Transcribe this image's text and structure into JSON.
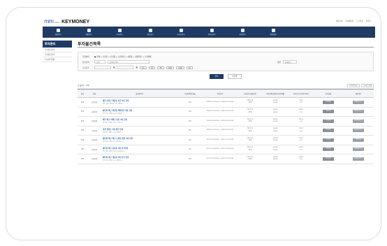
{
  "logo": {
    "mark": "mm",
    "small": "kesa",
    "text": "KEYMONEY"
  },
  "toplinks": [
    "대표전번",
    "마이페이지",
    "로그아웃",
    "정책보"
  ],
  "nav": [
    {
      "label": "회원관리",
      "icon": "user-icon"
    },
    {
      "label": "예결관리",
      "icon": "target-icon"
    },
    {
      "label": "투자관리",
      "icon": "chart-icon"
    },
    {
      "label": "정산관리",
      "icon": "gear-icon"
    },
    {
      "label": "게시판관리",
      "icon": "document-icon"
    },
    {
      "label": "관리자관리",
      "icon": "person-icon"
    },
    {
      "label": "통계관리",
      "icon": "stats-icon"
    },
    {
      "label": "환경설정",
      "icon": "settings-icon"
    }
  ],
  "sidebar": {
    "title": "투자관리",
    "items": [
      "투자물건관리",
      "투자물건관리",
      "투자관리현황"
    ]
  },
  "page_title": "투자물건목록",
  "search": {
    "row1_label": "진행상태",
    "row1_options": "● 전체 ○ 모집전 ○ 모집중 ○ 모집마감 ○ 상환중 ○ 상환완료 ○ 모집실패",
    "row2_label": "물건검색",
    "row2_select": "선택",
    "row2_placeholder": "검색어 입력",
    "row2_sort_label": "정렬",
    "row2_sort_value": "등록일순",
    "row3_label": "모집기간",
    "row3_chips": [
      "오늘",
      "1일",
      "3일",
      "1개월",
      "3개월",
      "1년"
    ],
    "search_btn": "검색",
    "reset_btn": "초기화"
  },
  "list": {
    "count": "총 물건수 : 176",
    "ctrl1": "20개씩보기",
    "ctrl2": "등록순 정렬"
  },
  "table": {
    "headers": [
      "번호",
      "상태",
      "물건명/주소",
      "모집금액/달성율",
      "모집기간",
      "모집한도/대출기간",
      "투자금액(만원)/모집진행률",
      "투자가능투자/투자목표",
      "투자현황",
      "메모관리"
    ],
    "rows": [
      {
        "no": "150",
        "status": "공모진행",
        "name": "예다 수원구 평촌동 상가 3층 건축",
        "addr": "경기 수원구 평촌동 1-15 (평촌동) 1",
        "rate": "0%",
        "period": "2018.01.20 00:00 ~ 2018.01.27 00:00",
        "limit": "월01170",
        "term": "3개월",
        "amount": "10,000",
        "target": "10,000",
        "p1": "100 %",
        "p2": "3 %",
        "b1": "투자현황",
        "b2": "메모바로가기"
      },
      {
        "no": "151",
        "status": "공모진행",
        "name": "예다야 해구 화성면 백화상가 5층 건축",
        "addr": "경기 해구 화성면 30-50 (화성동) 5",
        "rate": "0%",
        "period": "2018.01.20 00:00 ~ 2018.01.30 00:00",
        "limit": "월01170",
        "term": "3개월",
        "amount": "10,000",
        "target": "10,000",
        "p1": "100 %",
        "p2": "3 %",
        "b1": "투자현황",
        "b2": "메모바로가기"
      },
      {
        "no": "150",
        "status": "공모진행",
        "name": "예다 해구 하해구 동동 3층 건축",
        "addr": "경기 해구 하해구 18-21 (동동) 2",
        "rate": "0%",
        "period": "2018.01.20 00:00 ~ 2018.01.30 00:00",
        "limit": "월01170",
        "term": "3개월",
        "amount": "10,000",
        "target": "10,000",
        "p1": "100 %",
        "p2": "3 %",
        "b1": "투자현황",
        "b2": "메모바로가기"
      },
      {
        "no": "149",
        "status": "공모진행",
        "name": "경관 영종도 5층 빌라 건축",
        "addr": "인천 중구 영종도 320 (영종동) 3",
        "rate": "0%",
        "period": "2018.01.20 00:00 ~ 2018.01.30 00:00",
        "limit": "월01170",
        "term": "3개월",
        "amount": "10,000",
        "target": "10,000",
        "p1": "100 %",
        "p2": "3 %",
        "b1": "투자현황",
        "b2": "메모바로가기"
      },
      {
        "no": "148",
        "status": "공모진행",
        "name": "예다야 해구 해구 근처동 판촌 5층 건축",
        "addr": "경기 해구 근처동 112 (판촌동) 6",
        "rate": "0%",
        "period": "2017.12.30 00:00 ~ 2017.12.31 00:00",
        "limit": "월01170",
        "term": "3개월",
        "amount": "10,000",
        "target": "10,000",
        "p1": "100 %",
        "p2": "4 %",
        "b1": "투자현황",
        "b2": "메모보기"
      },
      {
        "no": "147",
        "status": "공모진행",
        "name": "예다야 해구 등운동 3층 상가건축",
        "addr": "경기 해구 등운동 130-11 (등운동) 4",
        "rate": "0%",
        "period": "2017.12.20 00:00 ~ 2017.12.30 00:00",
        "limit": "월01170",
        "term": "3개월",
        "amount": "10,000",
        "target": "10,000",
        "p1": "100 %",
        "p2": "3 %",
        "b1": "투자현황",
        "b2": "메모바로가기"
      },
      {
        "no": "146",
        "status": "공모진행",
        "name": "예다야 해구 개운동 3층 상가 건축",
        "addr": "경기 해구 개운동 230 (개운동) 3",
        "rate": "0%",
        "period": "2017.12.20 00:00 ~ 2017.12.30 00:00",
        "limit": "월01170",
        "term": "3개월",
        "amount": "10,000",
        "target": "10,000",
        "p1": "100 %",
        "p2": "3 %",
        "b1": "투자현황",
        "b2": "메모바로가기"
      }
    ]
  }
}
